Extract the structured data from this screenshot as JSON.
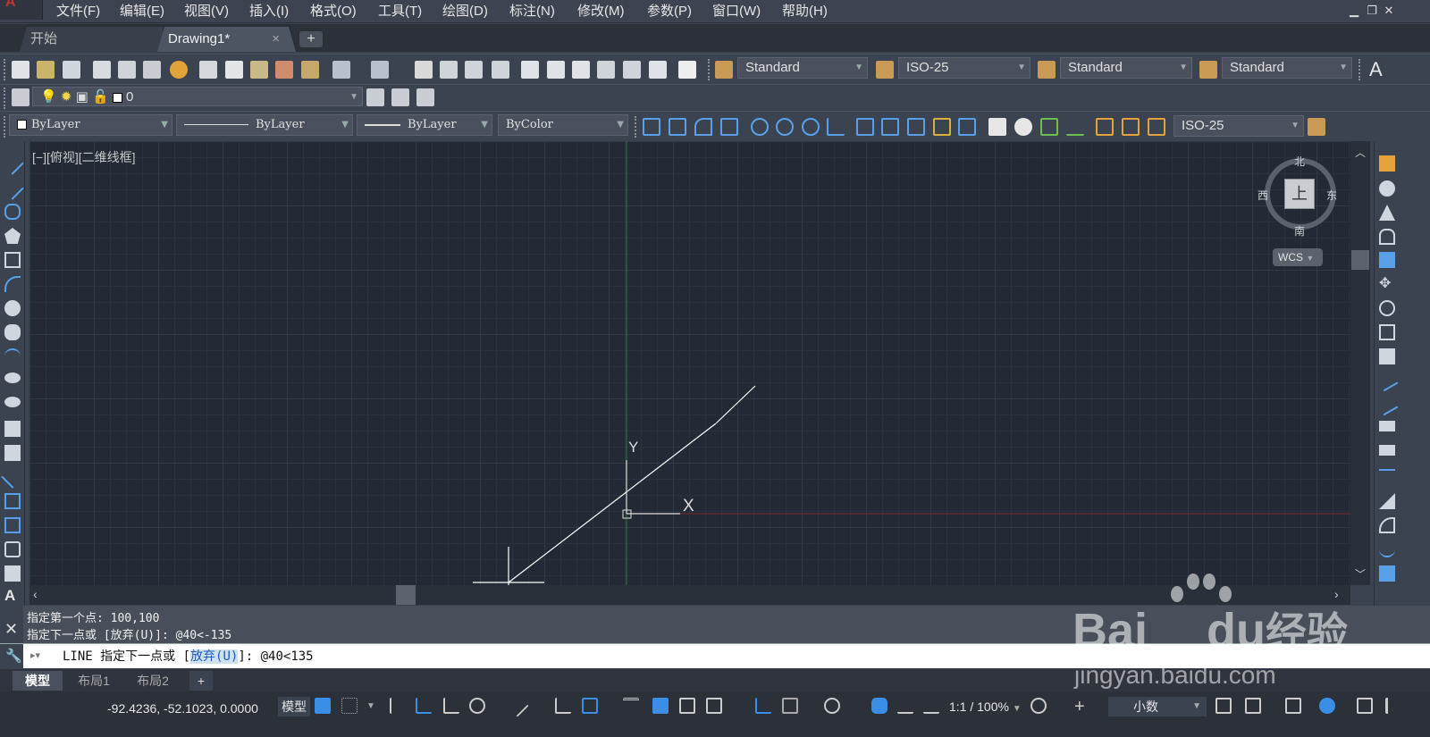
{
  "menubar": {
    "items": [
      "文件(F)",
      "编辑(E)",
      "视图(V)",
      "插入(I)",
      "格式(O)",
      "工具(T)",
      "绘图(D)",
      "标注(N)",
      "修改(M)",
      "参数(P)",
      "窗口(W)",
      "帮助(H)"
    ],
    "logo_icon": "autocad-logo-icon"
  },
  "tabs": {
    "start": "开始",
    "drawing": "Drawing1*",
    "close": "×",
    "add": "+"
  },
  "styles_toolbar": {
    "text_style": "Standard",
    "dim_style": "ISO-25",
    "table_style": "Standard",
    "multileader_style": "Standard",
    "text_icon": "A"
  },
  "layers_toolbar": {
    "current_layer": "0"
  },
  "properties_toolbar": {
    "color": "ByLayer",
    "linetype": "ByLayer",
    "lineweight": "ByLayer",
    "plotstyle": "ByColor"
  },
  "dimension_toolbar": {
    "dim_style": "ISO-25"
  },
  "viewport": {
    "label": "[−][俯视][二维线框]",
    "ucs_x": "X",
    "ucs_y": "Y"
  },
  "viewcube": {
    "north": "北",
    "south": "南",
    "east": "东",
    "west": "西",
    "top": "上",
    "wcs": "WCS"
  },
  "command": {
    "history": [
      "指定第一个点: 100,100",
      "指定下一点或 [放弃(U)]: @40<-135"
    ],
    "prefix": "LINE 指定下一点或 [",
    "keyword": "放弃(U)",
    "suffix": "]: @40<135"
  },
  "layout_tabs": [
    "模型",
    "布局1",
    "布局2"
  ],
  "layout_add": "+",
  "statusbar": {
    "coordinates": "-92.4236, -52.1023, 0.0000",
    "model": "模型",
    "scale": "1:1 / 100%",
    "units": "小数"
  },
  "watermark": {
    "brand": "Bai",
    "brand2": "du",
    "suffix": "经验",
    "url": "jingyan.baidu.com"
  },
  "colors": {
    "background": "#232a35",
    "ui_dark": "#3b4250",
    "accent_blue": "#3a8ee6",
    "x_axis": "#b22222",
    "y_axis": "#228b22"
  }
}
